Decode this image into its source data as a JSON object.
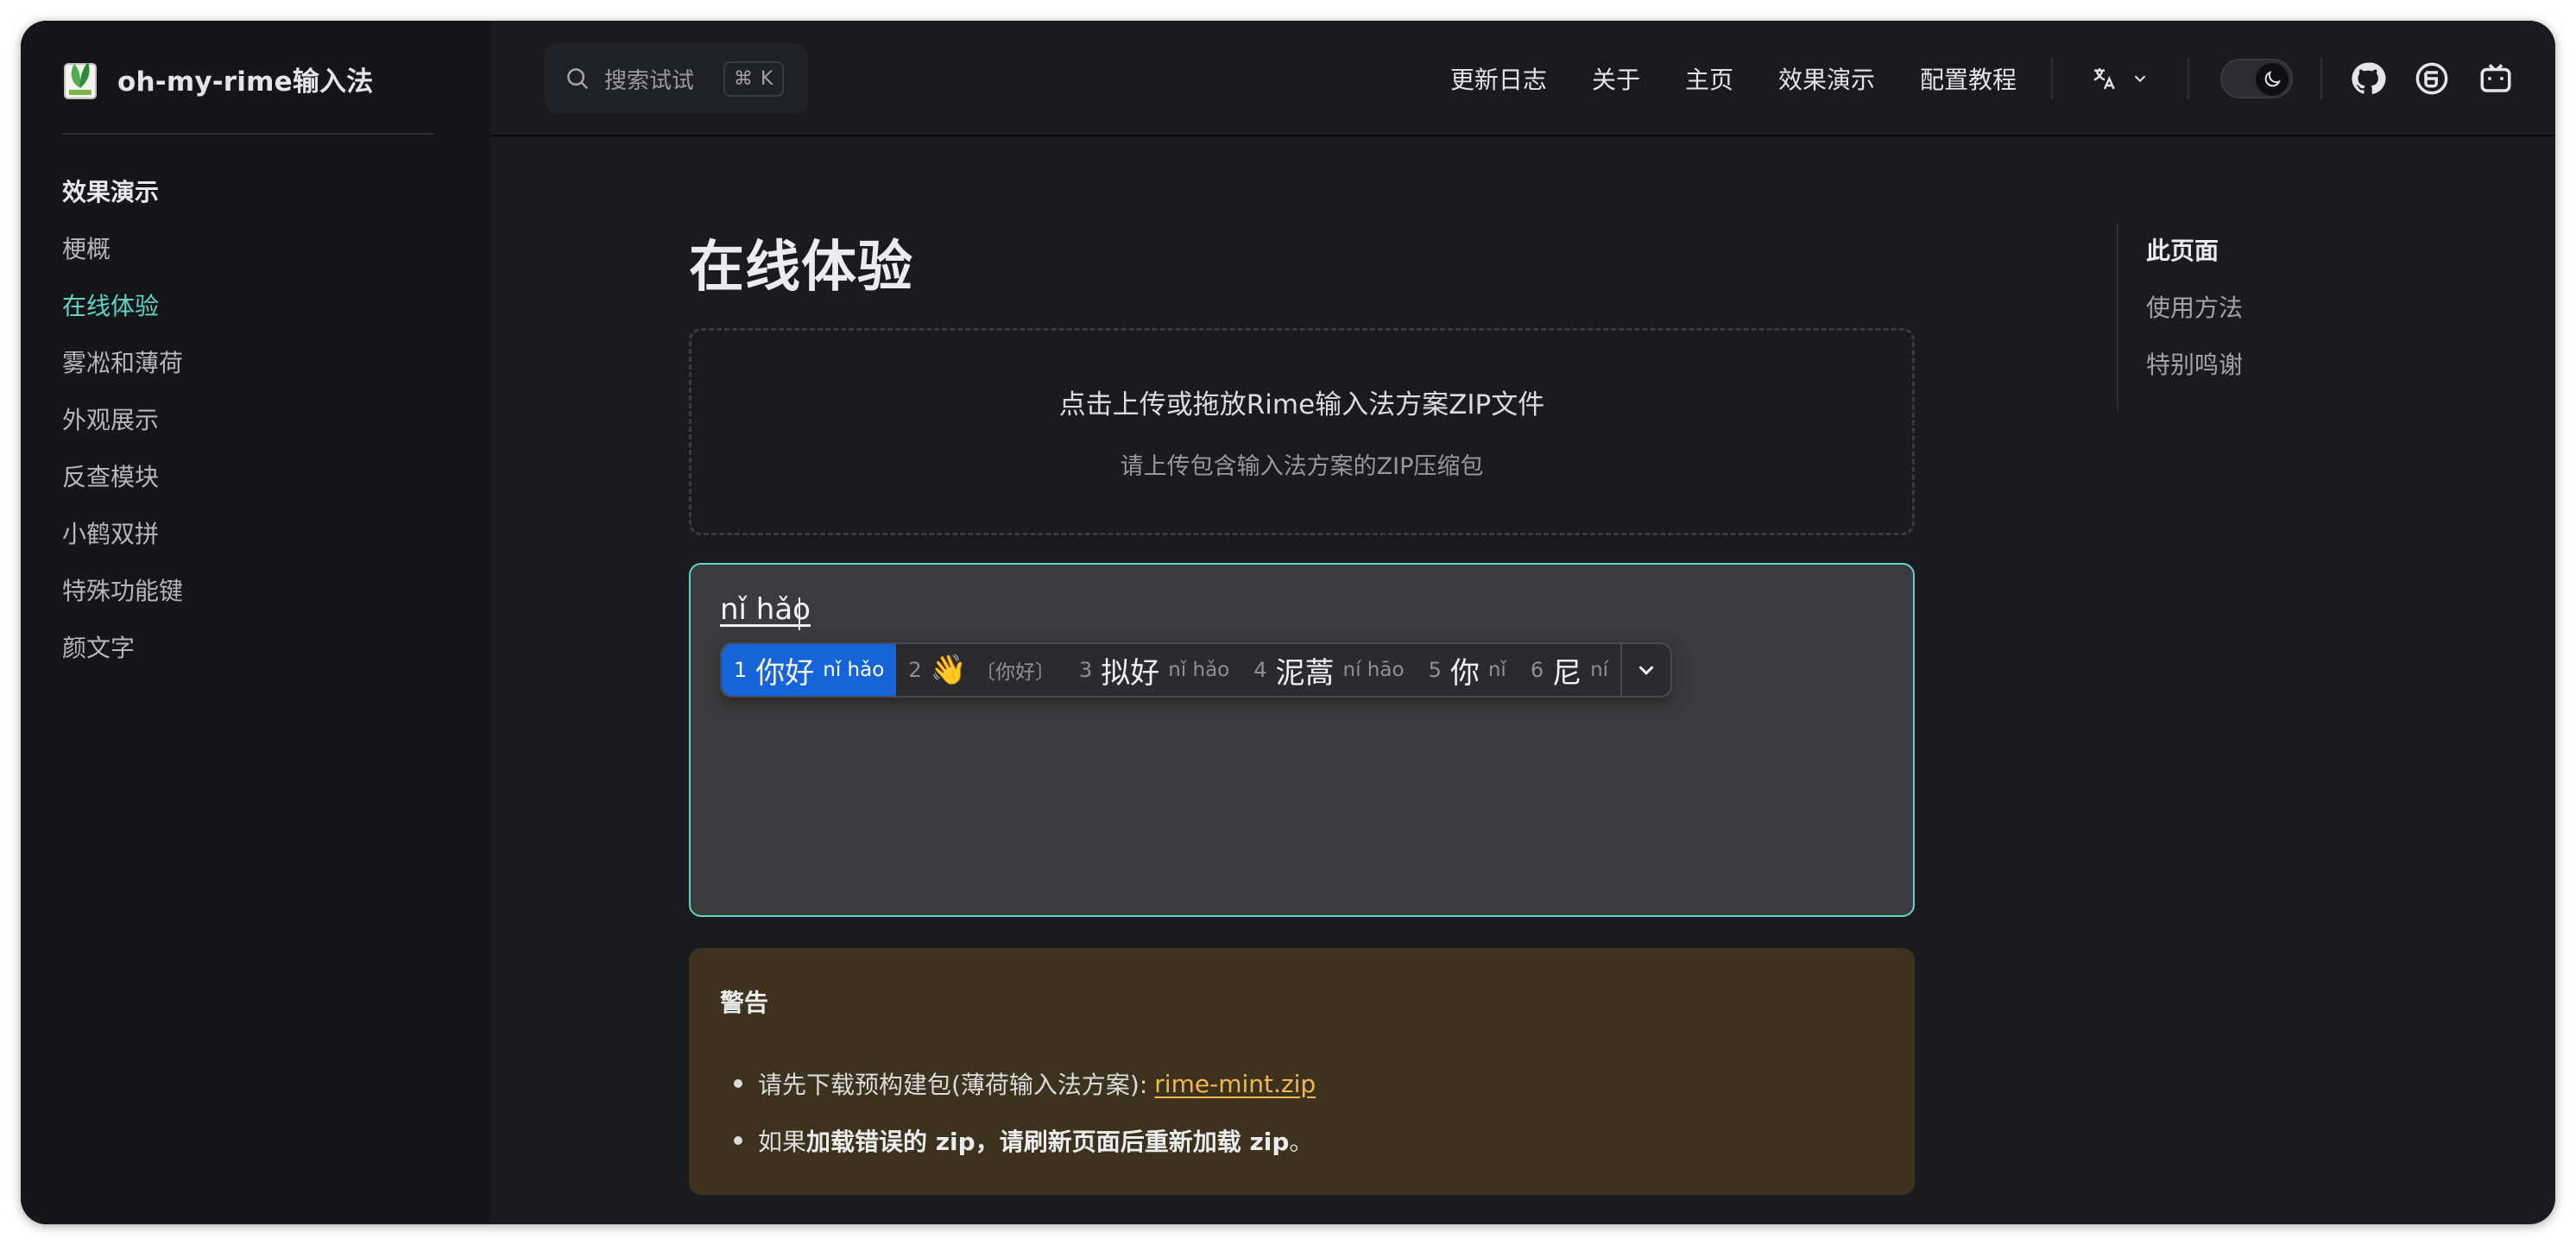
{
  "brand": {
    "title": "oh-my-rime输入法"
  },
  "sidebar": {
    "group_title": "效果演示",
    "items": [
      {
        "label": "梗概"
      },
      {
        "label": "在线体验",
        "active": true
      },
      {
        "label": "雾凇和薄荷"
      },
      {
        "label": "外观展示"
      },
      {
        "label": "反查模块"
      },
      {
        "label": "小鹤双拼"
      },
      {
        "label": "特殊功能键"
      },
      {
        "label": "颜文字"
      }
    ]
  },
  "search": {
    "placeholder": "搜索试试",
    "shortcut": "⌘ K"
  },
  "nav": {
    "links": [
      "更新日志",
      "关于",
      "主页",
      "效果演示",
      "配置教程"
    ]
  },
  "main": {
    "title": "在线体验",
    "upload": {
      "title": "点击上传或拖放Rime输入法方案ZIP文件",
      "subtitle": "请上传包含输入法方案的ZIP压缩包"
    },
    "editor": {
      "preedit": "nǐ hǎo",
      "candidates": [
        {
          "index": "1",
          "text": "你好",
          "comment": "nǐ hǎo",
          "selected": true
        },
        {
          "index": "2",
          "text": "👋",
          "comment": "〔你好〕"
        },
        {
          "index": "3",
          "text": "拟好",
          "comment": "nǐ hǎo"
        },
        {
          "index": "4",
          "text": "泥蒿",
          "comment": "ní hāo"
        },
        {
          "index": "5",
          "text": "你",
          "comment": "nǐ"
        },
        {
          "index": "6",
          "text": "尼",
          "comment": "ní"
        }
      ]
    },
    "warning": {
      "title": "警告",
      "item1_prefix": "请先下载预构建包(薄荷输入法方案):",
      "item1_link": "rime-mint.zip",
      "item2_prefix": "如果",
      "item2_bold": "加载错误的 zip，请刷新页面后重新加载 zip",
      "item2_suffix": "。"
    }
  },
  "outline": {
    "title": "此页面",
    "items": [
      "使用方法",
      "特别鸣谢"
    ]
  },
  "colors": {
    "accent": "#5fd4c9",
    "selected_candidate": "#1565d8",
    "warning_bg": "#3c321e",
    "link": "#f2b84b"
  }
}
